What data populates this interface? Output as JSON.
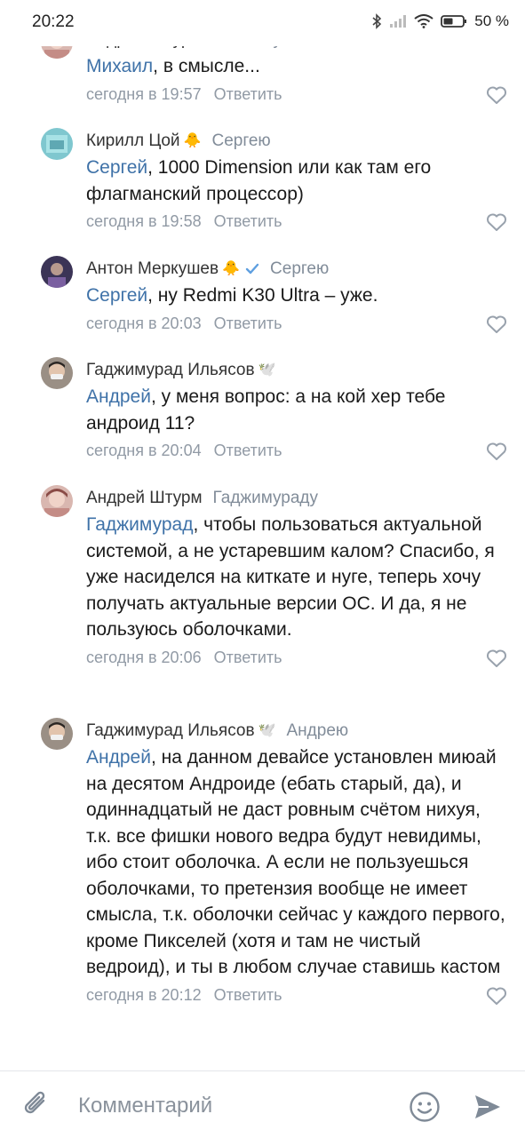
{
  "status_bar": {
    "time": "20:22",
    "battery": "50 %"
  },
  "comments": [
    {
      "author": "Андрей Штурм",
      "reply_to": "Михаилу",
      "emoji": "",
      "mention": "Михаил",
      "text": ", в смысле...",
      "time": "сегодня в 19:57",
      "reply_label": "Ответить"
    },
    {
      "author": "Кирилл Цой",
      "reply_to": "Сергею",
      "emoji": "🐥",
      "mention": "Сергей",
      "text": ", 1000 Dimension или как там его флагманский процессор)",
      "time": "сегодня в 19:58",
      "reply_label": "Ответить"
    },
    {
      "author": "Антон Меркушев",
      "reply_to": "Сергею",
      "emoji": "🐥",
      "mention": "Сергей",
      "text": ", ну Redmi K30 Ultra – уже.",
      "time": "сегодня в 20:03",
      "reply_label": "Ответить"
    },
    {
      "author": "Гаджимурад Ильясов",
      "reply_to": "",
      "emoji": "🕊️",
      "mention": "Андрей",
      "text": ", у меня вопрос: а на кой хер тебе андроид 11?",
      "time": "сегодня в 20:04",
      "reply_label": "Ответить"
    },
    {
      "author": "Андрей Штурм",
      "reply_to": "Гаджимураду",
      "emoji": "",
      "mention": "Гаджимурад",
      "text": ", чтобы пользоваться актуальной системой, а не устаревшим калом? Спасибо, я уже насиделся на киткате и нуге, теперь хочу получать актуальные версии ОС. И да, я не пользуюсь оболочками.",
      "time": "сегодня в 20:06",
      "reply_label": "Ответить"
    },
    {
      "author": "Гаджимурад Ильясов",
      "reply_to": "Андрею",
      "emoji": "🕊️",
      "mention": "Андрей",
      "text": ", на данном девайсе установлен миюай на десятом Андроиде (ебать старый, да), и одиннадцатый не даст ровным счётом нихуя, т.к. все фишки нового ведра будут невидимы, ибо стоит оболочка. А если не пользуешься оболочками, то претензия вообще не имеет смысла, т.к. оболочки сейчас у каждого первого, кроме Пикселей (хотя и там не чистый ведроид), и ты в любом случае ставишь кастом",
      "time": "сегодня в 20:12",
      "reply_label": "Ответить"
    }
  ],
  "composer": {
    "placeholder": "Комментарий"
  }
}
